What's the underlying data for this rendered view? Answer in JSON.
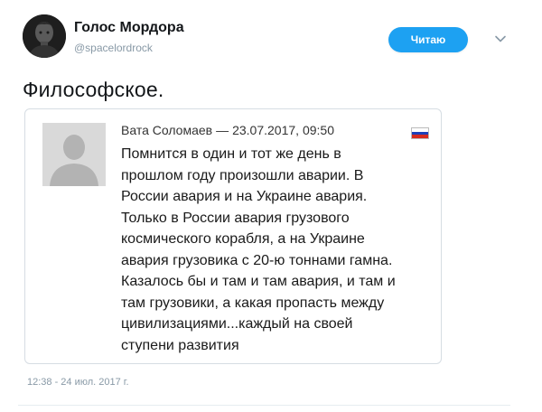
{
  "author": {
    "display_name": "Голос Мордора",
    "handle": "@spacelordrock",
    "avatar": "user-avatar-photo"
  },
  "actions": {
    "follow_label": "Читаю",
    "menu_icon": "chevron-down-icon"
  },
  "tweet": {
    "text": "Философское.",
    "timestamp": "12:38 - 24 июл. 2017 г."
  },
  "quoted": {
    "author": "Вата Соломаев",
    "separator": "—",
    "date": "23.07.2017, 09:50",
    "flag": "russia-flag-icon",
    "avatar": "default-user-silhouette",
    "lines": [
      "Помнится в один и тот же день в",
      "прошлом году произошли аварии. В",
      "России авария и на Украине авария.",
      "Только в России авария грузового",
      "космического корабля, а на Украине",
      "авария грузовика с 20-ю тоннами гамна.",
      "Казалось бы и там и там авария, и там и",
      "там грузовики, а какая пропасть между",
      "цивилизациями...каждый на своей",
      "ступени развития"
    ]
  },
  "colors": {
    "accent": "#1da1f2",
    "muted": "#8899a6",
    "flag_white": "#ffffff",
    "flag_blue": "#1c3fb8",
    "flag_red": "#d52b1e"
  }
}
